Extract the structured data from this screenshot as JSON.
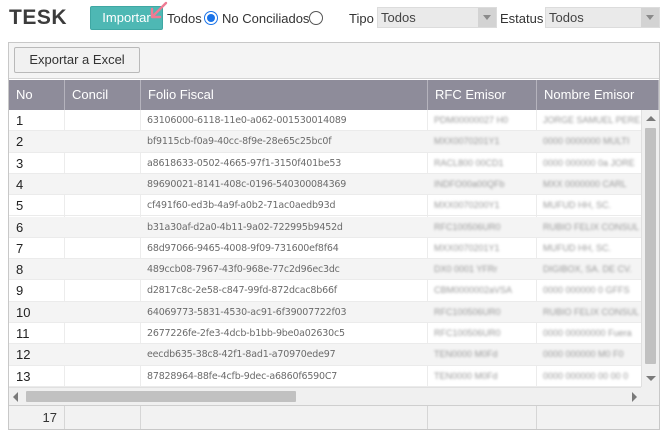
{
  "app": {
    "title": "TESK"
  },
  "toolbar": {
    "import_label": "Importar",
    "radio_todos_label": "Todos",
    "radio_no_conciliados_label": "No Conciliados",
    "radio_selected": "Todos",
    "tipo_label": "Tipo",
    "tipo_value": "Todos",
    "estatus_label": "Estatus",
    "estatus_value": "Todos"
  },
  "grid": {
    "export_label": "Exportar a Excel",
    "columns": [
      "No",
      "Concil",
      "Folio Fiscal",
      "RFC Emisor",
      "Nombre Emisor"
    ],
    "rows": [
      {
        "no": "1",
        "concil": "",
        "folio": "63106000-6118-11e0-a062-001530014089",
        "rfc": "PDM00000027 H0",
        "nombre": "JORGE SAMUEL PEREZ"
      },
      {
        "no": "2",
        "concil": "",
        "folio": "bf9115cb-f0a9-40cc-8f9e-28e65c25bc0f",
        "rfc": "MXX0070201Y1",
        "nombre": "0000 0000000 MULTI"
      },
      {
        "no": "3",
        "concil": "",
        "folio": "a8618633-0502-4665-97f1-3150f401be53",
        "rfc": "RACL800 00CD1",
        "nombre": "0000 000000 0a JORE"
      },
      {
        "no": "4",
        "concil": "",
        "folio": "89690021-8141-408c-0196-540300084369",
        "rfc": "INDFO00a00QFb",
        "nombre": "MXX 0000000 CARL"
      },
      {
        "no": "5",
        "concil": "",
        "folio": "cf491f60-ed3b-4a9f-a0b2-71ac0aedb93d",
        "rfc": "MXX0070200Y1",
        "nombre": "MUFUD HH, SC."
      },
      {
        "no": "6",
        "concil": "",
        "folio": "b31a30af-d2a0-4b11-9a02-722995b9452d",
        "rfc": "RFC100506UR0",
        "nombre": "RUBIO FELIX CONSUL"
      },
      {
        "no": "7",
        "concil": "",
        "folio": "68d97066-9465-4008-9f09-731600ef8f64",
        "rfc": "MXX0070201Y1",
        "nombre": "MUFUD HH, SC."
      },
      {
        "no": "8",
        "concil": "",
        "folio": "489ccb08-7967-43f0-968e-77c2d96ec3dc",
        "rfc": "DX0 0001 YFRr",
        "nombre": "DIGIBOX, SA. DE CV."
      },
      {
        "no": "9",
        "concil": "",
        "folio": "d2817c8c-2e58-c847-99fd-872dcac8b66f",
        "rfc": "CBM0000002aVSA",
        "nombre": "0000 000000 0 GFFS"
      },
      {
        "no": "10",
        "concil": "",
        "folio": "64069773-5831-4530-ac91-6f39007722f03",
        "rfc": "RFC100506UR0",
        "nombre": "RUBIO FELIX CONSUL"
      },
      {
        "no": "11",
        "concil": "",
        "folio": "2677226fe-2fe3-4dcb-b1bb-9be0a02630c5",
        "rfc": "RFC100506UR0",
        "nombre": "0000 00000000 Fuera"
      },
      {
        "no": "12",
        "concil": "",
        "folio": "eecdb635-38c8-42f1-8ad1-a70970ede97",
        "rfc": "TEN0000 M0Fd",
        "nombre": "0000 000000 M0 F0"
      },
      {
        "no": "13",
        "concil": "",
        "folio": "87828964-88fe-4cfb-9dec-a6860f6590C7",
        "rfc": "TEN0000 M0Fd",
        "nombre": "0000 000000 00 00 0"
      }
    ],
    "footer_count": "17"
  }
}
